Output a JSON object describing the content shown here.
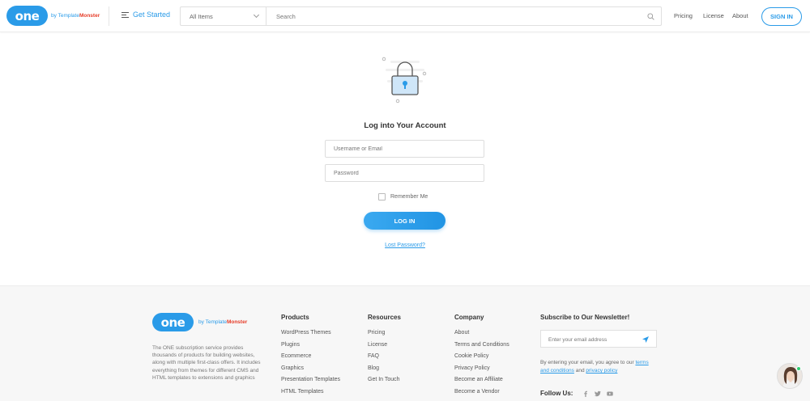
{
  "header": {
    "logo_text": "one",
    "logo_by": "by",
    "logo_brand_a": "Template",
    "logo_brand_b": "Monster",
    "get_started": "Get Started",
    "category_select": "All Items",
    "search_placeholder": "Search",
    "nav": [
      "Pricing",
      "License",
      "About"
    ],
    "signin": "SIGN IN"
  },
  "login": {
    "title": "Log into Your Account",
    "username_placeholder": "Username or Email",
    "password_placeholder": "Password",
    "remember": "Remember Me",
    "button": "LOG IN",
    "lost": "Lost Password?"
  },
  "footer": {
    "logo_text": "one",
    "logo_by": "by",
    "logo_brand_a": "Template",
    "logo_brand_b": "Monster",
    "description": "The ONE subscription service provides thousands of products for building websites, along with multiple first-class offers. It includes everything from themes for different CMS and HTML templates to extensions and graphics",
    "columns": [
      {
        "title": "Products",
        "items": [
          "WordPress Themes",
          "Plugins",
          "Ecommerce",
          "Graphics",
          "Presentation Templates",
          "HTML Templates"
        ]
      },
      {
        "title": "Resources",
        "items": [
          "Pricing",
          "License",
          "FAQ",
          "Blog",
          "Get In Touch"
        ]
      },
      {
        "title": "Company",
        "items": [
          "About",
          "Terms and Conditions",
          "Cookie Policy",
          "Privacy Policy",
          "Become an Affiliate",
          "Become a Vendor"
        ]
      }
    ],
    "newsletter_title": "Subscribe to Our Newsletter!",
    "email_placeholder": "Enter your email address",
    "terms_prefix": "By entering your email, you agree to our",
    "terms_link": "terms and conditions",
    "terms_and": "and",
    "privacy_link": "privacy policy",
    "follow": "Follow Us:"
  },
  "colors": {
    "accent": "#2a9be8",
    "brand_red": "#e63c28"
  },
  "icons": [
    "menu-icon",
    "chevron-down-icon",
    "search-icon",
    "lock-icon",
    "send-icon",
    "facebook-icon",
    "twitter-icon",
    "youtube-icon"
  ]
}
